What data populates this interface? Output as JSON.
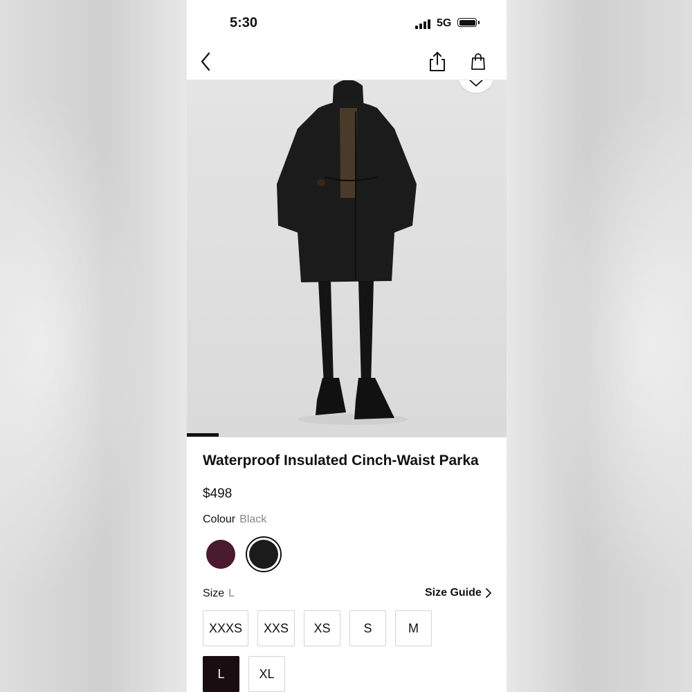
{
  "status_bar": {
    "time": "5:30",
    "network": "5G"
  },
  "nav": {
    "back_icon": "chevron-left-icon",
    "share_icon": "share-icon",
    "bag_icon": "shopping-bag-icon"
  },
  "gallery": {
    "favorite_icon": "heart-icon",
    "image_alt": "Model wearing black parka with leggings and hiking boots"
  },
  "product": {
    "title": "Waterproof Insulated Cinch-Waist Parka",
    "price": "$498",
    "colour_label": "Colour",
    "colour_value": "Black",
    "swatches": [
      {
        "name": "plum",
        "color": "#4a1a2e"
      },
      {
        "name": "black",
        "color": "#1b1b1b",
        "selected": true
      }
    ],
    "size_label": "Size",
    "size_value": "L",
    "size_guide": "Size Guide",
    "sizes": [
      "XXXS",
      "XXS",
      "XS",
      "S",
      "M",
      "L",
      "XL"
    ],
    "selected_size": "L"
  }
}
